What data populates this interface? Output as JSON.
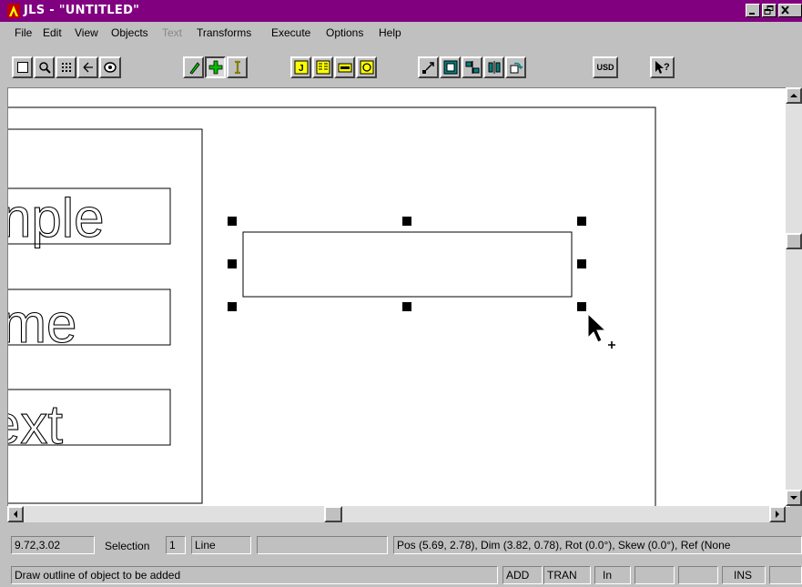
{
  "window": {
    "title": "JLS - \"UNTITLED\""
  },
  "menu": {
    "items": [
      {
        "label": "File"
      },
      {
        "label": "Edit"
      },
      {
        "label": "View"
      },
      {
        "label": "Objects"
      },
      {
        "label": "Text",
        "disabled": true
      },
      {
        "label": "Transforms"
      },
      {
        "label": "Execute"
      },
      {
        "label": "Options"
      },
      {
        "label": "Help"
      }
    ]
  },
  "toolbar": {
    "usd_label": "USD",
    "buttons": [
      "select-tool",
      "zoom-tool",
      "grid-tool",
      "arrow-tool",
      "view-tool",
      "edit-node-tool",
      "add-tool",
      "text-cursor-tool",
      "object-j-tool",
      "object-list-tool",
      "object-label-tool",
      "object-circle-tool",
      "move-tool",
      "resize-tool",
      "mirror-tool",
      "align-tool",
      "rotate-tool",
      "usd-tool",
      "help-tool"
    ]
  },
  "canvas": {
    "texts": [
      {
        "text": "nple"
      },
      {
        "text": "me"
      },
      {
        "text": "ext"
      }
    ],
    "selected_object": {
      "type": "Line"
    }
  },
  "status1": {
    "coords": "9.72,3.02",
    "selection_label": "Selection",
    "selection_count": "1",
    "object_type": "Line",
    "info": "Pos (5.69, 2.78), Dim (3.82, 0.78), Rot (0.0°), Skew (0.0°), Ref (None"
  },
  "status2": {
    "message": "Draw outline of object to be added",
    "mode_add": "ADD",
    "mode_tran": "TRAN",
    "units": "In",
    "ins": "INS"
  },
  "colors": {
    "titlebar": "#800080",
    "chrome": "#c0c0c0",
    "accent_yellow": "#ffff00",
    "accent_green": "#00c000",
    "accent_blue": "#008080"
  }
}
